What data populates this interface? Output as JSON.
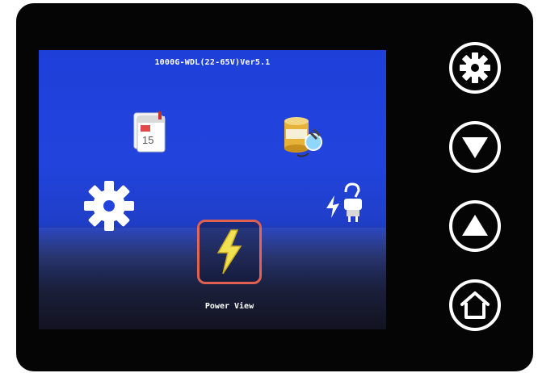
{
  "screen": {
    "version_text": "1000G-WDL(22-65V)Ver5.1",
    "menu": {
      "selected_label": "Power View"
    }
  },
  "icons": {
    "calendar": "calendar-icon",
    "database": "database-icon",
    "settings": "gear-icon",
    "utility": "power-plug-icon",
    "power": "lightning-bolt-icon"
  },
  "hardware_buttons": [
    "settings",
    "down",
    "up",
    "home"
  ],
  "colors": {
    "screen_blue": "#2244dd",
    "selection_border": "#e0614f",
    "bolt_yellow": "#f2e04a",
    "bezel": "#050505"
  }
}
